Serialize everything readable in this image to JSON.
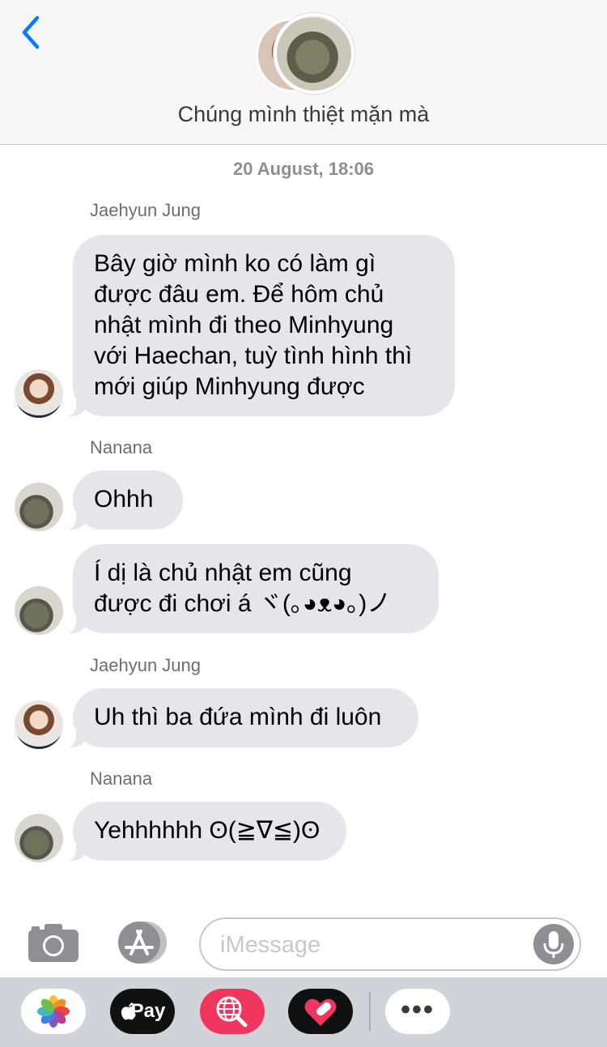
{
  "header": {
    "title": "Chúng mình thiệt mặn mà",
    "back_icon": "chevron-left-icon",
    "accent": "#007aff"
  },
  "timestamp": "20 August, 18:06",
  "messages": [
    {
      "sender": "Jaehyun Jung",
      "text_lines": [
        "Bây giờ mình ko có làm gì",
        "được đâu em. Để hôm chủ",
        "nhật mình đi theo Minhyung",
        "với Haechan, tuỳ tình hình thì",
        "mới giúp Minhyung được"
      ]
    },
    {
      "sender": "Nanana",
      "text": "Ohhh"
    },
    {
      "text_lines": [
        "Í dị là chủ nhật em cũng",
        "được đi chơi á ヾ(｡◕ᴥ◕｡)ノ"
      ]
    },
    {
      "sender": "Jaehyun Jung",
      "text": "Uh thì ba đứa mình đi luôn"
    },
    {
      "sender": "Nanana",
      "text": "Yehhhhhh ʘ(≧∇≦)ʘ"
    }
  ],
  "input": {
    "placeholder": "iMessage"
  },
  "apps": {
    "pay_label": "Pay",
    "more_label": "•••"
  }
}
